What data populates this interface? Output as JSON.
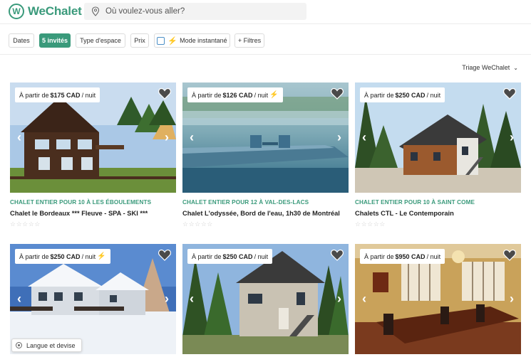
{
  "header": {
    "logo_text": "WeChalet",
    "logo_mark": "W",
    "search_placeholder": "Où voulez-vous aller?"
  },
  "filters": {
    "dates": "Dates",
    "guests": "5 invités",
    "space_type": "Type d'espace",
    "price": "Prix",
    "instant": "Mode instantané",
    "more": "+ Filtres"
  },
  "sort": {
    "label": "Triage WeChalet"
  },
  "listings": [
    {
      "prefix": "À partir de",
      "price": "$175 CAD",
      "unit": "/ nuit",
      "instant": false,
      "type": "CHALET ENTIER POUR 10 À LES ÉBOULEMENTS",
      "title": "Chalet le Bordeaux *** Fleuve - SPA - SKI ***",
      "rating": "☆☆☆☆☆"
    },
    {
      "prefix": "À partir de",
      "price": "$126 CAD",
      "unit": "/ nuit",
      "instant": true,
      "type": "CHALET ENTIER POUR 12 À VAL-DES-LACS",
      "title": "Chalet L'odyssée, Bord de l'eau, 1h30 de Montréal",
      "rating": "☆☆☆☆☆"
    },
    {
      "prefix": "À partir de",
      "price": "$250 CAD",
      "unit": "/ nuit",
      "instant": false,
      "type": "CHALET ENTIER POUR 10 À SAINT COME",
      "title": "Chalets CTL - Le Contemporain",
      "rating": "☆☆☆☆☆"
    },
    {
      "prefix": "À partir de",
      "price": "$250 CAD",
      "unit": "/ nuit",
      "instant": true,
      "type": "",
      "title": "",
      "rating": ""
    },
    {
      "prefix": "À partir de",
      "price": "$250 CAD",
      "unit": "/ nuit",
      "instant": false,
      "type": "",
      "title": "",
      "rating": ""
    },
    {
      "prefix": "À partir de",
      "price": "$950 CAD",
      "unit": "/ nuit",
      "instant": false,
      "type": "",
      "title": "",
      "rating": ""
    }
  ],
  "language_button": {
    "label": "Langue et devise"
  },
  "colors": {
    "brand": "#3a9a7b",
    "instant_bolt": "#f0b400"
  },
  "icons": {
    "search": "location-pin-icon",
    "heart": "heart-icon",
    "prev": "chevron-left-icon",
    "next": "chevron-right-icon"
  }
}
